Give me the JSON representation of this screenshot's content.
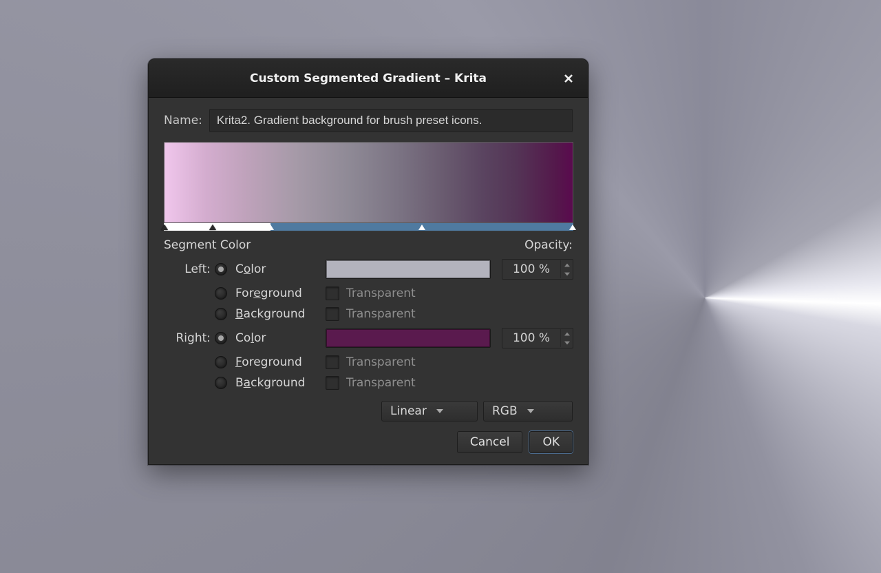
{
  "dialog": {
    "title": "Custom Segmented Gradient – Krita",
    "name_label": "Name:",
    "name_value": "Krita2. Gradient background for brush preset icons.",
    "segment_color_label": "Segment Color",
    "opacity_label": "Opacity:",
    "left": {
      "label": "Left:",
      "options": [
        "Color",
        "Foreground",
        "Background"
      ],
      "selected": 0,
      "swatch_color": "#b3b3bd",
      "opacity": "100 %",
      "transparent_label": "Transparent",
      "transparent_fg": false,
      "transparent_bg": false
    },
    "right": {
      "label": "Right:",
      "options": [
        "Color",
        "Foreground",
        "Background"
      ],
      "selected": 0,
      "swatch_color": "#5a1a4e",
      "opacity": "100 %",
      "transparent_label": "Transparent",
      "transparent_fg": false,
      "transparent_bg": false
    },
    "interp": {
      "value": "Linear"
    },
    "colorspace": {
      "value": "RGB"
    },
    "buttons": {
      "cancel": "Cancel",
      "ok": "OK"
    },
    "segments": [
      {
        "from": 0,
        "mid": 12,
        "to": 26,
        "selected": false
      },
      {
        "from": 26,
        "mid": 63,
        "to": 100,
        "selected": true
      }
    ]
  }
}
